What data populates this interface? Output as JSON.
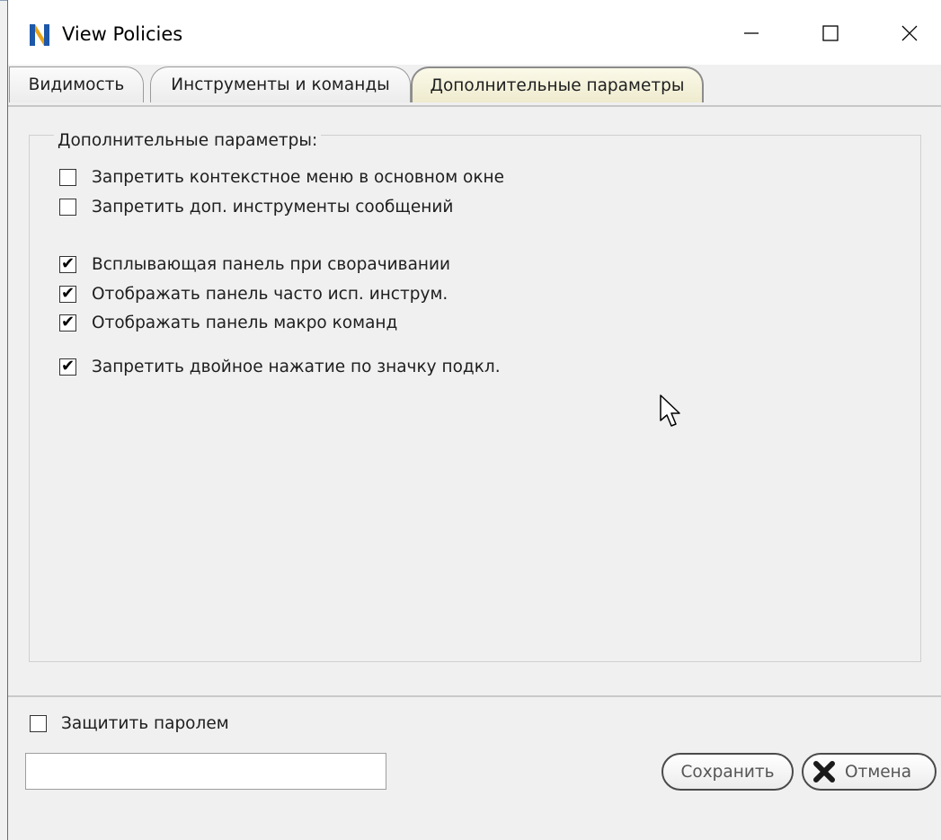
{
  "window": {
    "title": "View Policies",
    "controls": [
      "minimize",
      "maximize",
      "close"
    ]
  },
  "tabs": [
    {
      "label": "Видимость",
      "active": false
    },
    {
      "label": "Инструменты и команды",
      "active": false
    },
    {
      "label": "Дополнительные параметры",
      "active": true
    }
  ],
  "group": {
    "title": "Дополнительные параметры:",
    "options": [
      {
        "label": "Запретить контекстное меню в основном окне",
        "checked": false
      },
      {
        "label": "Запретить доп. инструменты сообщений",
        "checked": false
      },
      {
        "label": "Всплывающая панель при сворачивании",
        "checked": true
      },
      {
        "label": "Отображать панель часто исп. инструм.",
        "checked": true
      },
      {
        "label": "Отображать панель макро команд",
        "checked": true
      },
      {
        "label": "Запретить двойное нажатие по значку подкл.",
        "checked": true
      }
    ]
  },
  "password": {
    "label": "Защитить паролем",
    "checked": false,
    "value": ""
  },
  "buttons": {
    "save": "Сохранить",
    "cancel": "Отмена"
  },
  "colors": {
    "active_tab": "#f4f1d8",
    "window_bg": "#f0f0f0",
    "titlebar_bg": "#ffffff"
  },
  "icons": {
    "app": "app-logo-icon",
    "cancel": "x-icon",
    "cursor": "mouse-pointer-icon"
  }
}
